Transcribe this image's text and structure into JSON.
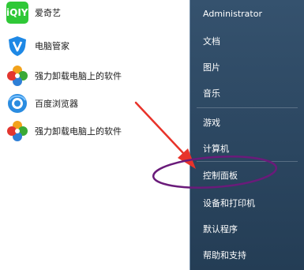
{
  "programs": [
    {
      "label": "爱奇艺",
      "icon": "iqiyi-icon",
      "icon_text": "iQIYI"
    },
    {
      "label": "电脑管家",
      "icon": "tencent-pc-manager-icon"
    },
    {
      "label": "强力卸载电脑上的软件",
      "icon": "uninstaller-icon"
    },
    {
      "label": "百度浏览器",
      "icon": "baidu-browser-icon"
    },
    {
      "label": "强力卸载电脑上的软件",
      "icon": "uninstaller-icon"
    }
  ],
  "menu": {
    "user": "Administrator",
    "documents": "文档",
    "pictures": "图片",
    "music": "音乐",
    "games": "游戏",
    "computer": "计算机",
    "control_panel": "控制面板",
    "devices_printers": "设备和打印机",
    "default_programs": "默认程序",
    "help_support": "帮助和支持"
  },
  "annotation": {
    "arrow_color": "#e8332a",
    "highlight_color": "#6a1b7a"
  },
  "colors": {
    "right_pane": "#2b4660",
    "left_pane": "#ffffff",
    "iqiyi_green": "#2fc837",
    "pc_manager_blue": "#1e88e5",
    "baidu_blue": "#2a8ce0"
  }
}
